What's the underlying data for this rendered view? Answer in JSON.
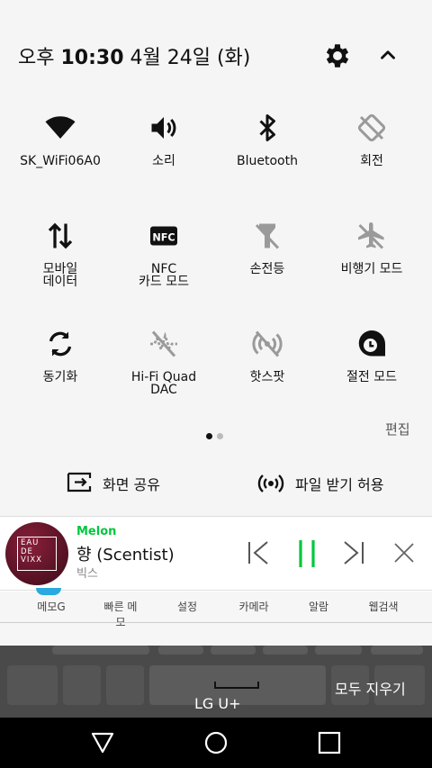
{
  "status": {
    "ampm": "오후",
    "time": "10:30",
    "date": "4월 24일 (화)"
  },
  "quick_tiles": [
    {
      "label": "SK_WiFi06A0",
      "icon": "wifi-icon",
      "active": true
    },
    {
      "label": "소리",
      "icon": "volume-icon",
      "active": true
    },
    {
      "label": "Bluetooth",
      "icon": "bluetooth-icon",
      "active": true
    },
    {
      "label": "회전",
      "icon": "rotation-lock-icon",
      "active": false
    },
    {
      "label": "모바일\n데이터",
      "icon": "mobile-data-icon",
      "active": true
    },
    {
      "label": "NFC\n카드 모드",
      "icon": "nfc-icon",
      "active": true
    },
    {
      "label": "손전등",
      "icon": "flashlight-off-icon",
      "active": false
    },
    {
      "label": "비행기 모드",
      "icon": "airplane-off-icon",
      "active": false
    },
    {
      "label": "동기화",
      "icon": "sync-icon",
      "active": true
    },
    {
      "label": "Hi-Fi Quad\nDAC",
      "icon": "hifi-dac-off-icon",
      "active": false
    },
    {
      "label": "핫스팟",
      "icon": "hotspot-off-icon",
      "active": false
    },
    {
      "label": "절전 모드",
      "icon": "battery-saver-icon",
      "active": true
    }
  ],
  "edit_label": "편집",
  "share": {
    "screen_share": "화면 공유",
    "file_receive": "파일 받기 허용"
  },
  "music": {
    "app": "Melon",
    "track": "향 (Scentist)",
    "artist": "빅스",
    "album_text": "EAU\nDE\nVIXX"
  },
  "quickbar": [
    "메모G",
    "빠른 메모",
    "설정",
    "카메라",
    "알람",
    "웹검색"
  ],
  "notification": {
    "clear_all": "모두 지우기",
    "carrier": "LG U+"
  },
  "colors": {
    "accent_green": "#00c73c",
    "inactive_icon": "#9a9a9a",
    "panel_bg": "#f5f5f5"
  }
}
